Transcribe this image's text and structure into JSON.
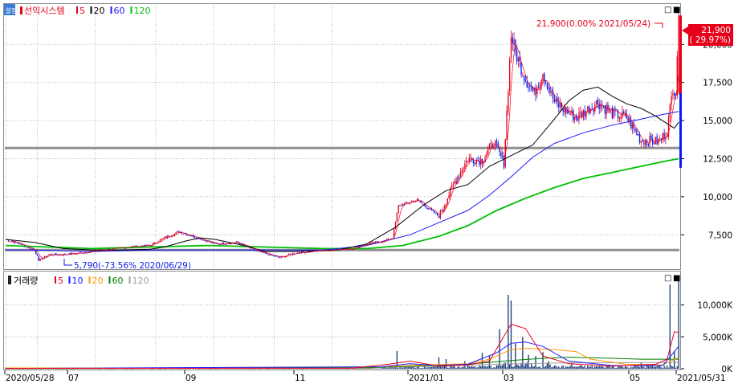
{
  "window": {
    "mini_btn": "□",
    "close_btn": "■"
  },
  "price_panel": {
    "side_icon": "설정",
    "stock_name": "선익시스템",
    "ma_legend": [
      {
        "label": "5",
        "color": "#e8001a"
      },
      {
        "label": "20",
        "color": "#000000"
      },
      {
        "label": "60",
        "color": "#1a1aff"
      },
      {
        "label": "120",
        "color": "#00c000"
      }
    ],
    "y_ticks": [
      "20,000",
      "17,500",
      "15,000",
      "12,500",
      "10,000",
      "7,500"
    ],
    "y_tick_values": [
      20000,
      17500,
      15000,
      12500,
      10000,
      7500
    ],
    "current_price_label": "21,900",
    "current_change_label": "( 29.97%)",
    "high_annotation": "21,900(0.00% 2021/05/24)",
    "low_annotation": "5,790(-73.56% 2020/06/29)",
    "hlines": [
      13200,
      6500
    ]
  },
  "volume_panel": {
    "title": "거래량",
    "ma_legend": [
      {
        "label": "5",
        "color": "#e8001a"
      },
      {
        "label": "10",
        "color": "#1a1aff"
      },
      {
        "label": "20",
        "color": "#ff9900"
      },
      {
        "label": "60",
        "color": "#008000"
      },
      {
        "label": "120",
        "color": "#a0a0a0"
      }
    ],
    "y_ticks": [
      "10,000K",
      "5,000K",
      "0K"
    ],
    "y_tick_values": [
      10000,
      5000,
      0
    ]
  },
  "x_axis": {
    "labels": [
      "2020/05/28",
      "07",
      "09",
      "11",
      "2021/01",
      "03",
      "05",
      "2021/05/31"
    ]
  },
  "colors": {
    "up": "#e8001a",
    "down": "#0a1aee",
    "hline": "#909090",
    "grid": "#b8b8b8"
  },
  "chart_data": {
    "type": "candlestick",
    "ylim": [
      5300,
      22600
    ],
    "volume_ylim": [
      0,
      15000
    ],
    "series": [
      {
        "name": "5",
        "color": "#e8001a"
      },
      {
        "name": "20",
        "color": "#000000"
      },
      {
        "name": "60",
        "color": "#1a1aff"
      },
      {
        "name": "120",
        "color": "#00c000"
      }
    ],
    "ma20_points": [
      [
        0,
        7200
      ],
      [
        20,
        7000
      ],
      [
        40,
        6600
      ],
      [
        60,
        6500
      ],
      [
        80,
        6500
      ],
      [
        100,
        6550
      ],
      [
        110,
        6700
      ],
      [
        125,
        7100
      ],
      [
        135,
        7300
      ],
      [
        145,
        7200
      ],
      [
        165,
        6800
      ],
      [
        180,
        6400
      ],
      [
        200,
        6400
      ],
      [
        230,
        6500
      ],
      [
        250,
        6900
      ],
      [
        270,
        8000
      ],
      [
        290,
        9500
      ],
      [
        305,
        10400
      ],
      [
        320,
        10800
      ],
      [
        335,
        12000
      ],
      [
        350,
        12700
      ],
      [
        365,
        13400
      ],
      [
        380,
        15100
      ],
      [
        390,
        16300
      ],
      [
        400,
        17000
      ],
      [
        410,
        17200
      ],
      [
        420,
        16600
      ],
      [
        430,
        16100
      ],
      [
        440,
        15800
      ],
      [
        450,
        15300
      ],
      [
        458,
        14800
      ],
      [
        463,
        14500
      ],
      [
        466,
        14900
      ]
    ],
    "ma60_points": [
      [
        0,
        6500
      ],
      [
        20,
        6500
      ],
      [
        60,
        6400
      ],
      [
        100,
        6500
      ],
      [
        140,
        6500
      ],
      [
        180,
        6500
      ],
      [
        220,
        6500
      ],
      [
        250,
        6800
      ],
      [
        280,
        7500
      ],
      [
        300,
        8300
      ],
      [
        320,
        9100
      ],
      [
        335,
        10100
      ],
      [
        350,
        11300
      ],
      [
        365,
        12600
      ],
      [
        380,
        13500
      ],
      [
        400,
        14200
      ],
      [
        420,
        14700
      ],
      [
        440,
        15100
      ],
      [
        455,
        15400
      ],
      [
        466,
        15600
      ]
    ],
    "ma120_points": [
      [
        0,
        6800
      ],
      [
        60,
        6600
      ],
      [
        100,
        6700
      ],
      [
        140,
        6800
      ],
      [
        180,
        6700
      ],
      [
        220,
        6600
      ],
      [
        250,
        6600
      ],
      [
        275,
        6800
      ],
      [
        300,
        7400
      ],
      [
        320,
        8100
      ],
      [
        340,
        9100
      ],
      [
        360,
        9900
      ],
      [
        380,
        10600
      ],
      [
        400,
        11200
      ],
      [
        420,
        11600
      ],
      [
        440,
        12000
      ],
      [
        455,
        12300
      ],
      [
        466,
        12500
      ]
    ],
    "vol_ma5_points": [
      [
        0,
        60
      ],
      [
        240,
        80
      ],
      [
        265,
        700
      ],
      [
        280,
        1200
      ],
      [
        300,
        400
      ],
      [
        320,
        600
      ],
      [
        335,
        1200
      ],
      [
        350,
        7000
      ],
      [
        360,
        6300
      ],
      [
        372,
        2000
      ],
      [
        390,
        800
      ],
      [
        420,
        400
      ],
      [
        450,
        700
      ],
      [
        458,
        1500
      ],
      [
        463,
        5800
      ],
      [
        466,
        5700
      ]
    ],
    "vol_ma10_points": [
      [
        0,
        50
      ],
      [
        260,
        300
      ],
      [
        280,
        800
      ],
      [
        300,
        500
      ],
      [
        320,
        700
      ],
      [
        340,
        2500
      ],
      [
        350,
        4000
      ],
      [
        360,
        4200
      ],
      [
        372,
        3500
      ],
      [
        390,
        1200
      ],
      [
        420,
        500
      ],
      [
        455,
        500
      ],
      [
        466,
        3500
      ]
    ],
    "vol_ma20_points": [
      [
        0,
        40
      ],
      [
        260,
        300
      ],
      [
        290,
        600
      ],
      [
        320,
        800
      ],
      [
        335,
        1500
      ],
      [
        350,
        3000
      ],
      [
        360,
        3200
      ],
      [
        380,
        3000
      ],
      [
        395,
        2700
      ],
      [
        405,
        1500
      ],
      [
        430,
        700
      ],
      [
        455,
        600
      ],
      [
        466,
        1800
      ]
    ],
    "vol_ma60_points": [
      [
        0,
        30
      ],
      [
        250,
        150
      ],
      [
        280,
        400
      ],
      [
        310,
        600
      ],
      [
        330,
        900
      ],
      [
        350,
        1300
      ],
      [
        370,
        1600
      ],
      [
        390,
        1800
      ],
      [
        410,
        1700
      ],
      [
        440,
        1500
      ],
      [
        466,
        1500
      ]
    ],
    "vol_ma120_points": [
      [
        0,
        30
      ],
      [
        200,
        80
      ],
      [
        260,
        200
      ],
      [
        300,
        400
      ],
      [
        340,
        700
      ],
      [
        380,
        900
      ],
      [
        420,
        950
      ],
      [
        466,
        1000
      ]
    ]
  }
}
